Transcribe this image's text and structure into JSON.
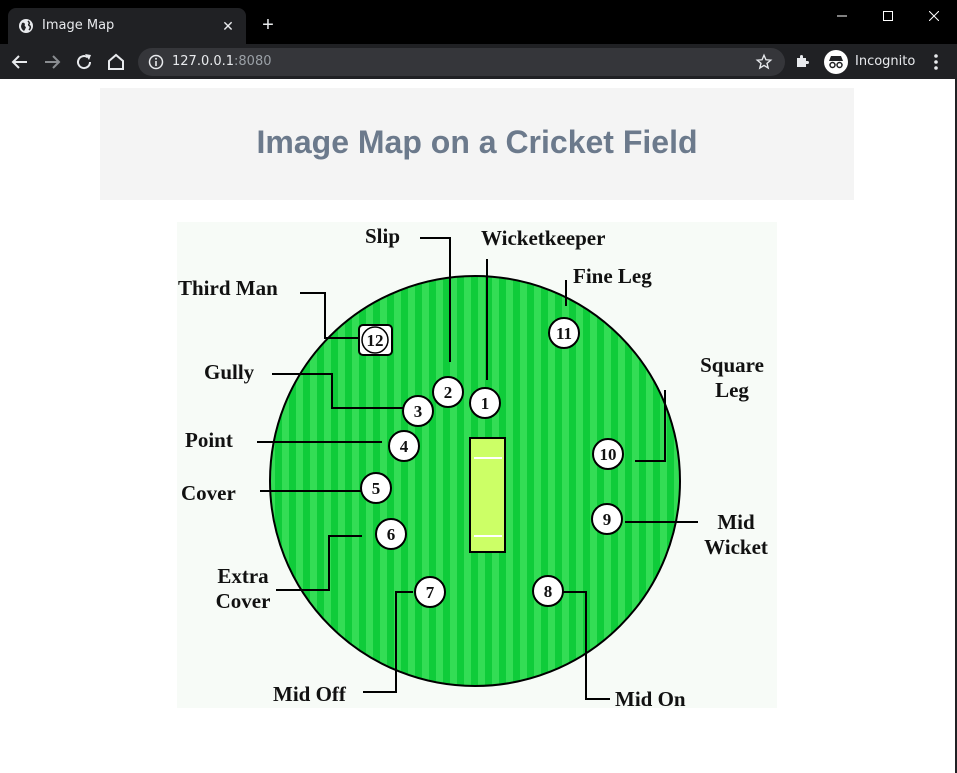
{
  "browser": {
    "tab_title": "Image Map",
    "url_host": "127.0.0.1",
    "url_port": ":8080",
    "profile_label": "Incognito"
  },
  "page": {
    "heading": "Image Map on a Cricket Field"
  },
  "field": {
    "labels": {
      "slip": "Slip",
      "wicketkeeper": "Wicketkeeper",
      "fine_leg": "Fine Leg",
      "third_man": "Third Man",
      "gully": "Gully",
      "square_leg_1": "Square",
      "square_leg_2": "Leg",
      "point": "Point",
      "cover": "Cover",
      "mid_wicket_1": "Mid",
      "mid_wicket_2": "Wicket",
      "extra_cover_1": "Extra",
      "extra_cover_2": "Cover",
      "mid_off": "Mid Off",
      "mid_on": "Mid On"
    },
    "positions": {
      "p1": "1",
      "p2": "2",
      "p3": "3",
      "p4": "4",
      "p5": "5",
      "p6": "6",
      "p7": "7",
      "p8": "8",
      "p9": "9",
      "p10": "10",
      "p11": "11",
      "p12": "12"
    },
    "colors": {
      "grass": "#0fcc3a",
      "grass_stripe": "#33dd55",
      "pitch": "#ccff66",
      "background": "#f7fbf7"
    }
  }
}
